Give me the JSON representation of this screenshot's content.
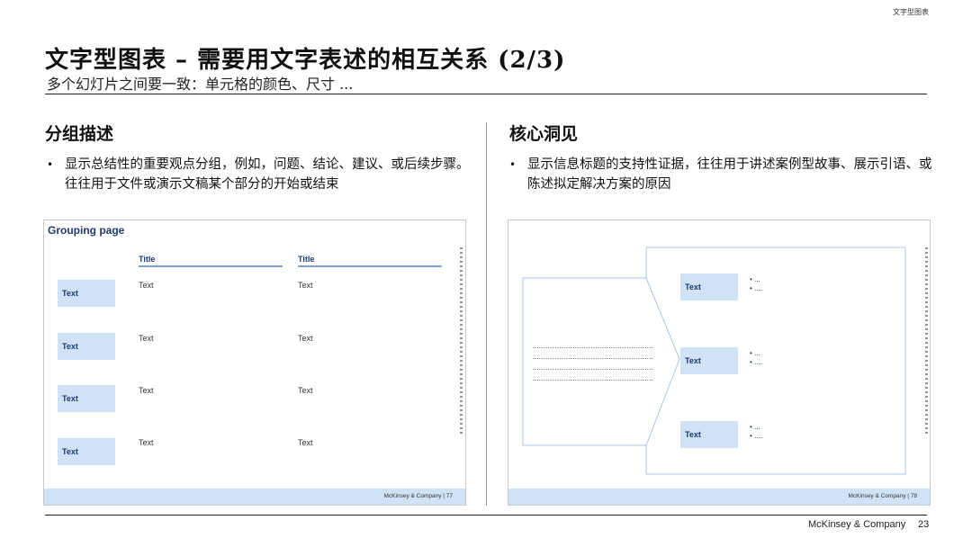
{
  "header": {
    "tracker": "文字型图表",
    "title": "文字型图表 – 需要用文字表述的相互关系 (2/3)",
    "subtitle": "多个幻灯片之间要一致：单元格的颜色、尺寸 ..."
  },
  "left_column": {
    "heading": "分组描述",
    "bullet_dot": "•",
    "bullet": "显示总结性的重要观点分组，例如，问题、结论、建议、或后续步骤。往往用于文件或演示文稿某个部分的开始或结束",
    "thumbnail": {
      "heading": "Grouping page",
      "columns": [
        "Title",
        "Title"
      ],
      "rows": [
        {
          "label": "Text",
          "cells": [
            "Text",
            "Text"
          ]
        },
        {
          "label": "Text",
          "cells": [
            "Text",
            "Text"
          ]
        },
        {
          "label": "Text",
          "cells": [
            "Text",
            "Text"
          ]
        },
        {
          "label": "Text",
          "cells": [
            "Text",
            "Text"
          ]
        }
      ],
      "footer": "McKinsey & Company  |  77"
    }
  },
  "right_column": {
    "heading": "核心洞见",
    "bullet_dot": "•",
    "bullet": "显示信息标题的支持性证据，往往用于讲述案例型故事、展示引语、或陈述拟定解决方案的原因",
    "thumbnail": {
      "dotted_lines": [
        "......................................................",
        "......................................................",
        "......................................................",
        "......................................................"
      ],
      "items": [
        {
          "label": "Text",
          "bullets": [
            "• ...",
            "• ...."
          ]
        },
        {
          "label": "Text",
          "bullets": [
            "• ...",
            "• ...."
          ]
        },
        {
          "label": "Text",
          "bullets": [
            "• ...",
            "• ...."
          ]
        }
      ],
      "footer": "McKinsey & Company  |  78"
    }
  },
  "footer": {
    "brand": "McKinsey & Company",
    "page": "23"
  }
}
